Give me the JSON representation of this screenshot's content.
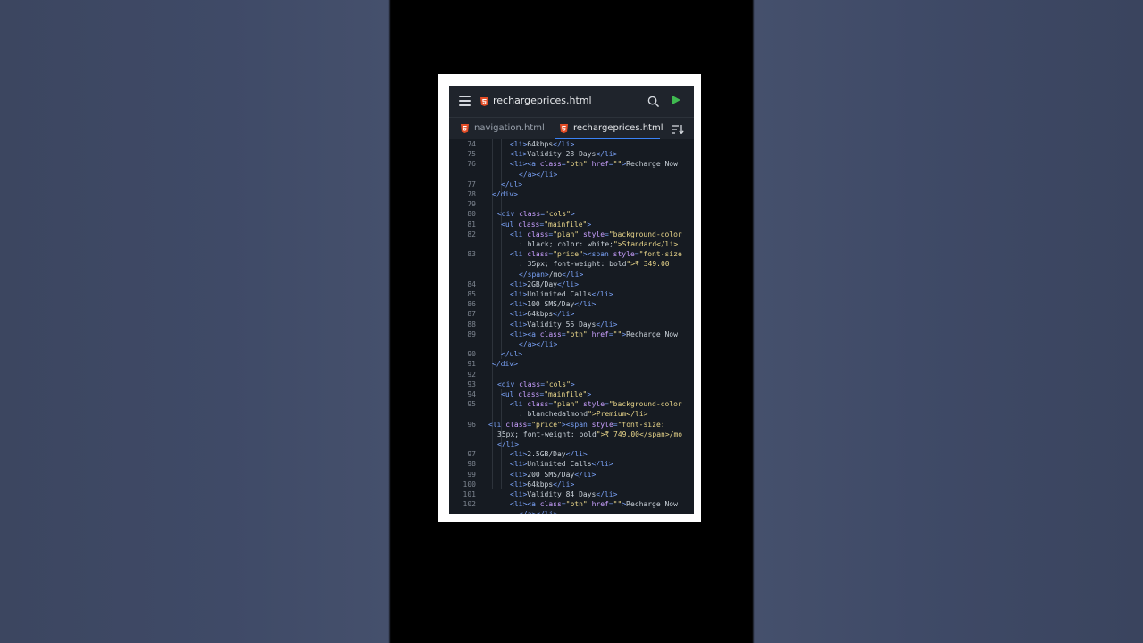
{
  "app": {
    "title": "rechargeprices.html",
    "tabs": [
      {
        "label": "navigation.html",
        "active": false
      },
      {
        "label": "rechargeprices.html",
        "active": true
      }
    ]
  },
  "icons": {
    "menu": "hamburger-menu-icon",
    "file": "html5-icon",
    "search": "search-icon",
    "run": "play-icon",
    "sort": "sort-icon"
  },
  "colors": {
    "editor_bg": "#161b22",
    "toolbar_bg": "#1f242c",
    "tag": "#7aa2f7",
    "attribute": "#c9a0ff",
    "string": "#e8d58a",
    "text": "#c9d1d9",
    "run": "#3fb950",
    "html5": "#e44d26"
  },
  "code_lines": [
    {
      "n": "74",
      "text": "<li>64kbps</li>"
    },
    {
      "n": "75",
      "text": "<li>Validity 28 Days</li>"
    },
    {
      "n": "76",
      "text": "<li><a class=\"btn\" href=\"\">Recharge Now"
    },
    {
      "n": "",
      "text": "</a></li>"
    },
    {
      "n": "77",
      "text": "</ul>"
    },
    {
      "n": "78",
      "text": "</div>"
    },
    {
      "n": "79",
      "text": ""
    },
    {
      "n": "80",
      "text": "<div class=\"cols\">"
    },
    {
      "n": "81",
      "text": "<ul class=\"mainfile\">"
    },
    {
      "n": "82",
      "text": "<li class=\"plan\" style=\"background-color"
    },
    {
      "n": "",
      "text": ": black; color: white;\">Standard</li>"
    },
    {
      "n": "83",
      "text": "<li class=\"price\"><span style=\"font-size"
    },
    {
      "n": "",
      "text": ": 35px; font-weight: bold\">₹ 349.00"
    },
    {
      "n": "",
      "text": "</span>/mo</li>"
    },
    {
      "n": "84",
      "text": "<li>2GB/Day</li>"
    },
    {
      "n": "85",
      "text": "<li>Unlimited Calls</li>"
    },
    {
      "n": "86",
      "text": "<li>100 SMS/Day</li>"
    },
    {
      "n": "87",
      "text": "<li>64kbps</li>"
    },
    {
      "n": "88",
      "text": "<li>Validity 56 Days</li>"
    },
    {
      "n": "89",
      "text": "<li><a class=\"btn\" href=\"\">Recharge Now"
    },
    {
      "n": "",
      "text": "</a></li>"
    },
    {
      "n": "90",
      "text": "</ul>"
    },
    {
      "n": "91",
      "text": "</div>"
    },
    {
      "n": "92",
      "text": ""
    },
    {
      "n": "93",
      "text": "<div class=\"cols\">"
    },
    {
      "n": "94",
      "text": "<ul class=\"mainfile\">"
    },
    {
      "n": "95",
      "text": "<li class=\"plan\" style=\"background-color"
    },
    {
      "n": "",
      "text": ": blanchedalmond\">Premium</li>"
    },
    {
      "n": "96",
      "text": "<li class=\"price\"><span style=\"font-size:"
    },
    {
      "n": "",
      "text": "35px; font-weight: bold\">₹ 749.00</span>/mo"
    },
    {
      "n": "",
      "text": "</li>"
    },
    {
      "n": "97",
      "text": "<li>2.5GB/Day</li>"
    },
    {
      "n": "98",
      "text": "<li>Unlimited Calls</li>"
    },
    {
      "n": "99",
      "text": "<li>200 SMS/Day</li>"
    },
    {
      "n": "100",
      "text": "<li>64kbps</li>"
    },
    {
      "n": "101",
      "text": "<li>Validity 84 Days</li>"
    },
    {
      "n": "102",
      "text": "<li><a class=\"btn\" href=\"\">Recharge Now"
    },
    {
      "n": "",
      "text": "</a></li>"
    }
  ]
}
